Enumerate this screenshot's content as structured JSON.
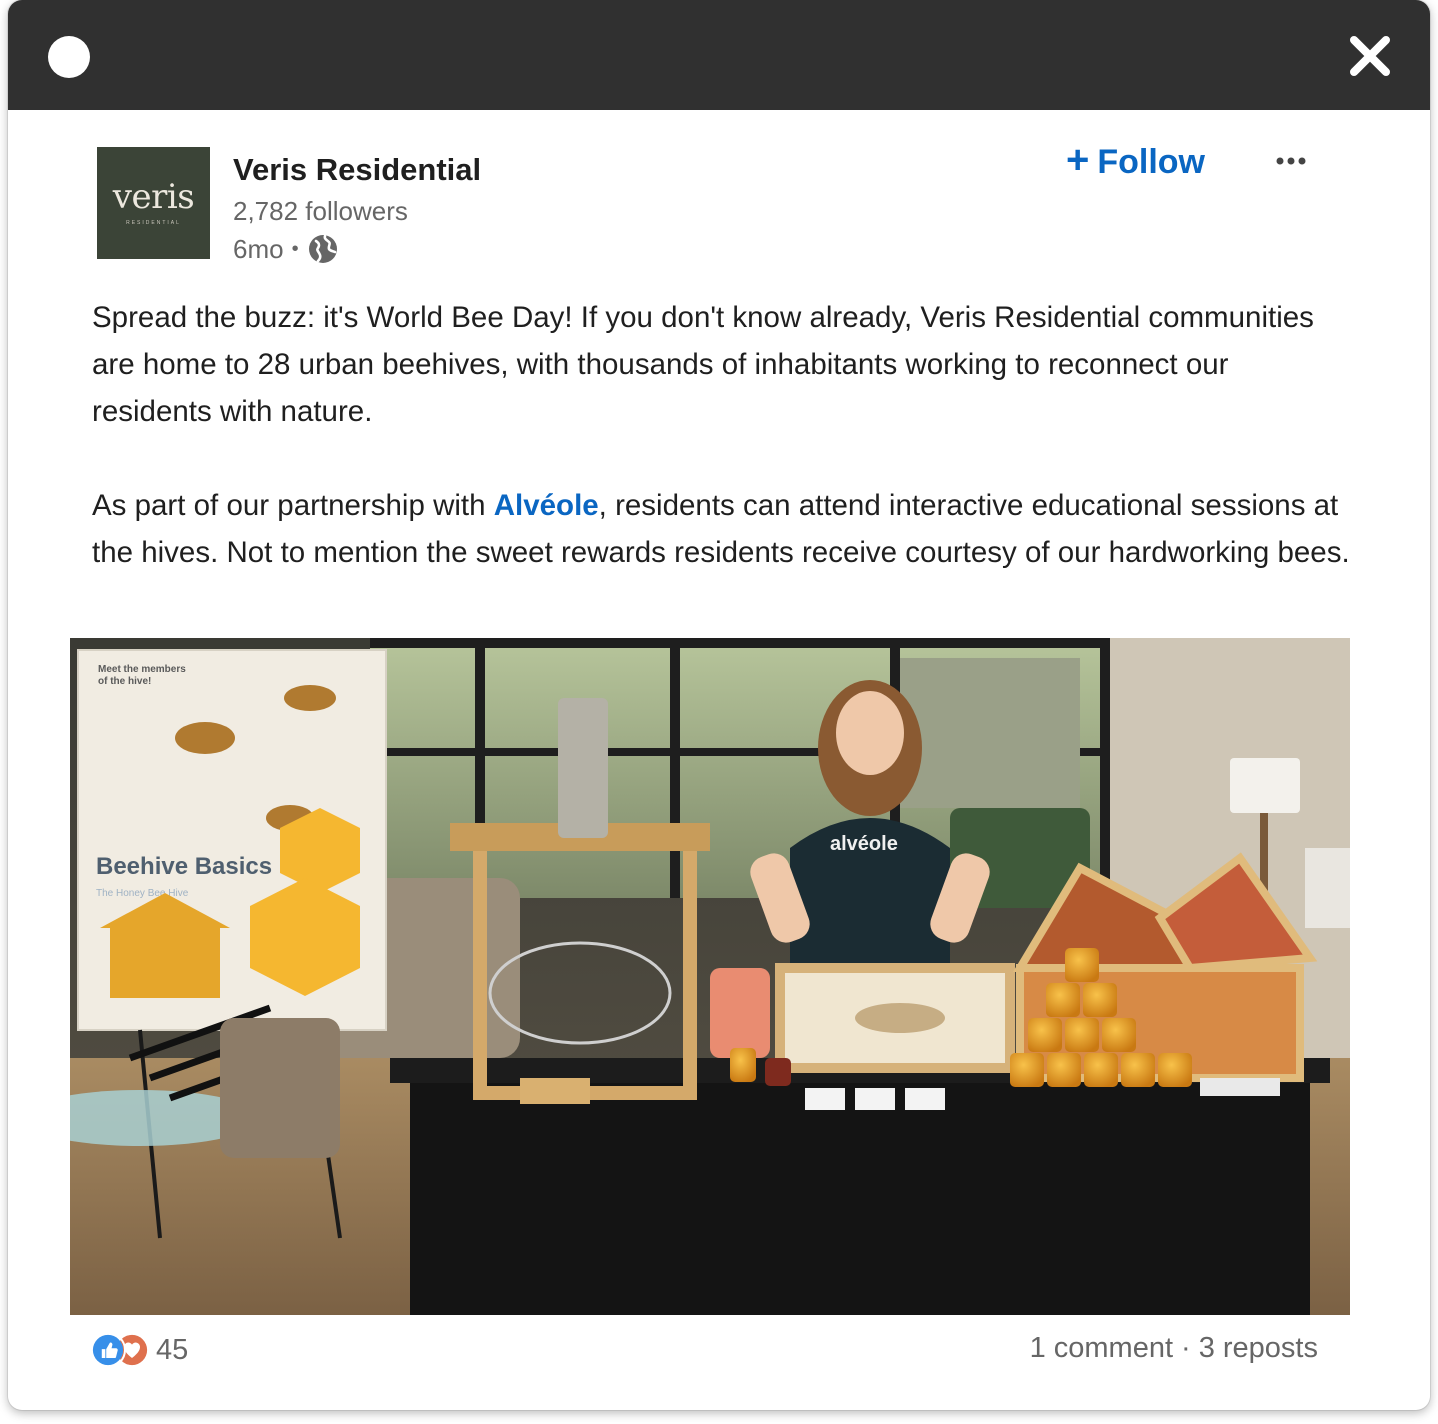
{
  "post": {
    "author": {
      "name": "Veris Residential",
      "followers": "2,782 followers",
      "age": "6mo",
      "separator": "•",
      "logo_text": "veris",
      "logo_subtext": "RESIDENTIAL",
      "logo_color": "#3b4437"
    },
    "follow_label": "Follow",
    "follow_icon": "plus-icon",
    "more_icon": "ellipsis-icon",
    "visibility_icon": "globe-icon",
    "body": {
      "p1": "Spread the buzz: it's World Bee Day! If you don't know already, Veris Residential communities are home to 28 urban beehives, with thousands of inhabitants working to reconnect our residents with nature.",
      "p2_before": "As part of our partnership with ",
      "mention": "Alvéole",
      "p2_after": ", residents can attend interactive educational sessions at the hives. Not to mention the sweet rewards residents receive courtesy of our hardworking bees."
    },
    "photo": {
      "poster_title": "Beehive Basics",
      "poster_subtitle": "The Honey Bee Hive",
      "poster_caption": "Meet the members of the hive!",
      "shirt_text": "alvéole"
    },
    "social": {
      "reaction_icons": [
        "like-icon",
        "love-icon"
      ],
      "reaction_count": "45",
      "comments": "1 comment",
      "separator": "·",
      "reposts": "3 reposts"
    }
  },
  "window": {
    "titlebar_color": "#303030",
    "close_icon": "close-icon"
  },
  "colors": {
    "link": "#0a66c2",
    "text": "#1f1f1f",
    "muted": "#666666"
  }
}
